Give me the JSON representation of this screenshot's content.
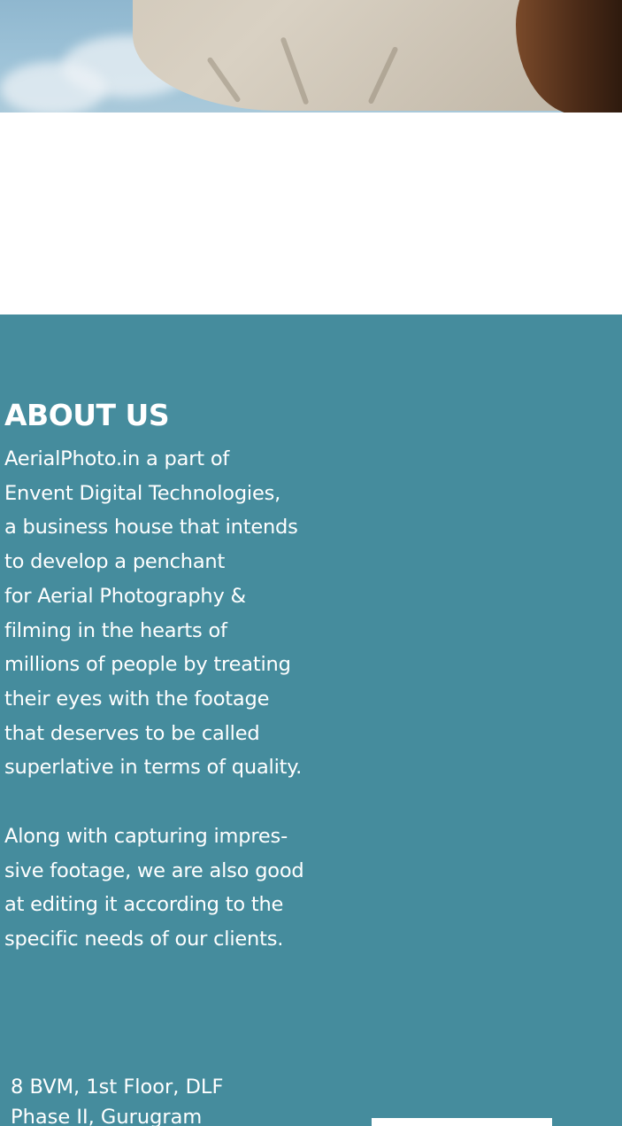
{
  "about": {
    "title": "ABOUT US",
    "paragraph1": [
      "AerialPhoto.in a part of",
      "Envent Digital Technologies,",
      "a business house  that intends",
      "to develop a penchant",
      "for Aerial Photography &",
      "filming in the hearts of",
      "millions of people by treating",
      "their eyes with the footage",
      "that deserves to be called",
      "superlative in terms of quality."
    ],
    "paragraph2": [
      "Along with capturing impres-",
      "sive footage, we are also good",
      "at editing it according to the",
      "specific needs of our clients."
    ]
  },
  "footer": {
    "address": [
      "8 BVM, 1st Floor, DLF",
      "Phase II, Gurugram"
    ]
  },
  "colors": {
    "about_background": "#458c9d",
    "text": "#ffffff"
  }
}
